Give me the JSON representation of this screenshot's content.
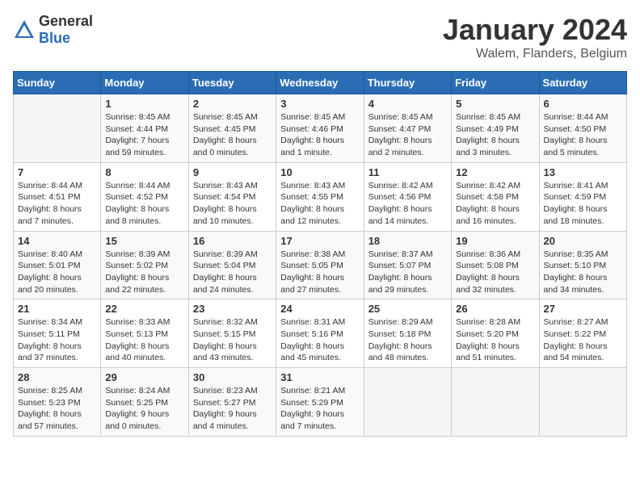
{
  "logo": {
    "general": "General",
    "blue": "Blue"
  },
  "header": {
    "month": "January 2024",
    "location": "Walem, Flanders, Belgium"
  },
  "weekdays": [
    "Sunday",
    "Monday",
    "Tuesday",
    "Wednesday",
    "Thursday",
    "Friday",
    "Saturday"
  ],
  "weeks": [
    [
      {
        "day": "",
        "sunrise": "",
        "sunset": "",
        "daylight": ""
      },
      {
        "day": "1",
        "sunrise": "Sunrise: 8:45 AM",
        "sunset": "Sunset: 4:44 PM",
        "daylight": "Daylight: 7 hours and 59 minutes."
      },
      {
        "day": "2",
        "sunrise": "Sunrise: 8:45 AM",
        "sunset": "Sunset: 4:45 PM",
        "daylight": "Daylight: 8 hours and 0 minutes."
      },
      {
        "day": "3",
        "sunrise": "Sunrise: 8:45 AM",
        "sunset": "Sunset: 4:46 PM",
        "daylight": "Daylight: 8 hours and 1 minute."
      },
      {
        "day": "4",
        "sunrise": "Sunrise: 8:45 AM",
        "sunset": "Sunset: 4:47 PM",
        "daylight": "Daylight: 8 hours and 2 minutes."
      },
      {
        "day": "5",
        "sunrise": "Sunrise: 8:45 AM",
        "sunset": "Sunset: 4:49 PM",
        "daylight": "Daylight: 8 hours and 3 minutes."
      },
      {
        "day": "6",
        "sunrise": "Sunrise: 8:44 AM",
        "sunset": "Sunset: 4:50 PM",
        "daylight": "Daylight: 8 hours and 5 minutes."
      }
    ],
    [
      {
        "day": "7",
        "sunrise": "Sunrise: 8:44 AM",
        "sunset": "Sunset: 4:51 PM",
        "daylight": "Daylight: 8 hours and 7 minutes."
      },
      {
        "day": "8",
        "sunrise": "Sunrise: 8:44 AM",
        "sunset": "Sunset: 4:52 PM",
        "daylight": "Daylight: 8 hours and 8 minutes."
      },
      {
        "day": "9",
        "sunrise": "Sunrise: 8:43 AM",
        "sunset": "Sunset: 4:54 PM",
        "daylight": "Daylight: 8 hours and 10 minutes."
      },
      {
        "day": "10",
        "sunrise": "Sunrise: 8:43 AM",
        "sunset": "Sunset: 4:55 PM",
        "daylight": "Daylight: 8 hours and 12 minutes."
      },
      {
        "day": "11",
        "sunrise": "Sunrise: 8:42 AM",
        "sunset": "Sunset: 4:56 PM",
        "daylight": "Daylight: 8 hours and 14 minutes."
      },
      {
        "day": "12",
        "sunrise": "Sunrise: 8:42 AM",
        "sunset": "Sunset: 4:58 PM",
        "daylight": "Daylight: 8 hours and 16 minutes."
      },
      {
        "day": "13",
        "sunrise": "Sunrise: 8:41 AM",
        "sunset": "Sunset: 4:59 PM",
        "daylight": "Daylight: 8 hours and 18 minutes."
      }
    ],
    [
      {
        "day": "14",
        "sunrise": "Sunrise: 8:40 AM",
        "sunset": "Sunset: 5:01 PM",
        "daylight": "Daylight: 8 hours and 20 minutes."
      },
      {
        "day": "15",
        "sunrise": "Sunrise: 8:39 AM",
        "sunset": "Sunset: 5:02 PM",
        "daylight": "Daylight: 8 hours and 22 minutes."
      },
      {
        "day": "16",
        "sunrise": "Sunrise: 8:39 AM",
        "sunset": "Sunset: 5:04 PM",
        "daylight": "Daylight: 8 hours and 24 minutes."
      },
      {
        "day": "17",
        "sunrise": "Sunrise: 8:38 AM",
        "sunset": "Sunset: 5:05 PM",
        "daylight": "Daylight: 8 hours and 27 minutes."
      },
      {
        "day": "18",
        "sunrise": "Sunrise: 8:37 AM",
        "sunset": "Sunset: 5:07 PM",
        "daylight": "Daylight: 8 hours and 29 minutes."
      },
      {
        "day": "19",
        "sunrise": "Sunrise: 8:36 AM",
        "sunset": "Sunset: 5:08 PM",
        "daylight": "Daylight: 8 hours and 32 minutes."
      },
      {
        "day": "20",
        "sunrise": "Sunrise: 8:35 AM",
        "sunset": "Sunset: 5:10 PM",
        "daylight": "Daylight: 8 hours and 34 minutes."
      }
    ],
    [
      {
        "day": "21",
        "sunrise": "Sunrise: 8:34 AM",
        "sunset": "Sunset: 5:11 PM",
        "daylight": "Daylight: 8 hours and 37 minutes."
      },
      {
        "day": "22",
        "sunrise": "Sunrise: 8:33 AM",
        "sunset": "Sunset: 5:13 PM",
        "daylight": "Daylight: 8 hours and 40 minutes."
      },
      {
        "day": "23",
        "sunrise": "Sunrise: 8:32 AM",
        "sunset": "Sunset: 5:15 PM",
        "daylight": "Daylight: 8 hours and 43 minutes."
      },
      {
        "day": "24",
        "sunrise": "Sunrise: 8:31 AM",
        "sunset": "Sunset: 5:16 PM",
        "daylight": "Daylight: 8 hours and 45 minutes."
      },
      {
        "day": "25",
        "sunrise": "Sunrise: 8:29 AM",
        "sunset": "Sunset: 5:18 PM",
        "daylight": "Daylight: 8 hours and 48 minutes."
      },
      {
        "day": "26",
        "sunrise": "Sunrise: 8:28 AM",
        "sunset": "Sunset: 5:20 PM",
        "daylight": "Daylight: 8 hours and 51 minutes."
      },
      {
        "day": "27",
        "sunrise": "Sunrise: 8:27 AM",
        "sunset": "Sunset: 5:22 PM",
        "daylight": "Daylight: 8 hours and 54 minutes."
      }
    ],
    [
      {
        "day": "28",
        "sunrise": "Sunrise: 8:25 AM",
        "sunset": "Sunset: 5:23 PM",
        "daylight": "Daylight: 8 hours and 57 minutes."
      },
      {
        "day": "29",
        "sunrise": "Sunrise: 8:24 AM",
        "sunset": "Sunset: 5:25 PM",
        "daylight": "Daylight: 9 hours and 0 minutes."
      },
      {
        "day": "30",
        "sunrise": "Sunrise: 8:23 AM",
        "sunset": "Sunset: 5:27 PM",
        "daylight": "Daylight: 9 hours and 4 minutes."
      },
      {
        "day": "31",
        "sunrise": "Sunrise: 8:21 AM",
        "sunset": "Sunset: 5:29 PM",
        "daylight": "Daylight: 9 hours and 7 minutes."
      },
      {
        "day": "",
        "sunrise": "",
        "sunset": "",
        "daylight": ""
      },
      {
        "day": "",
        "sunrise": "",
        "sunset": "",
        "daylight": ""
      },
      {
        "day": "",
        "sunrise": "",
        "sunset": "",
        "daylight": ""
      }
    ]
  ]
}
